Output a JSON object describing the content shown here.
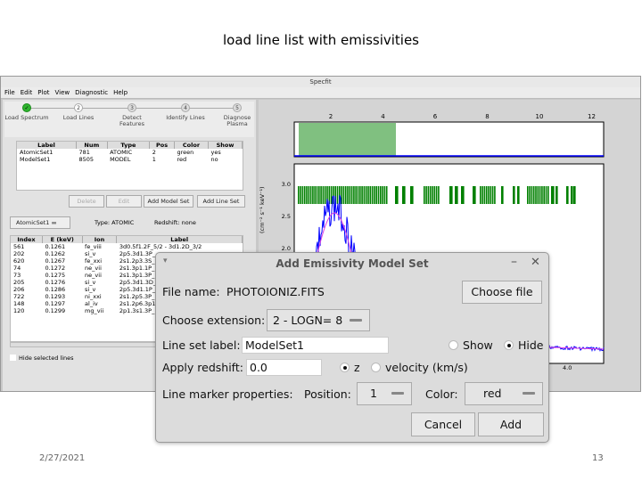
{
  "slide": {
    "title": "load line list with emissivities",
    "date": "2/27/2021",
    "page": "13"
  },
  "window": {
    "title": "Specfit"
  },
  "menu": [
    "File",
    "Edit",
    "Plot",
    "View",
    "Diagnostic",
    "Help"
  ],
  "wizard": [
    {
      "num": "✓",
      "label": "Load Spectrum",
      "done": true
    },
    {
      "num": "2",
      "label": "Load Lines"
    },
    {
      "num": "3",
      "label": "Detect Features"
    },
    {
      "num": "4",
      "label": "Identify Lines"
    },
    {
      "num": "5",
      "label": "Diagnose Plasma"
    }
  ],
  "linesets": {
    "headers": [
      "Label",
      "Num",
      "Type",
      "Pos",
      "Color",
      "Show"
    ],
    "rows": [
      [
        "AtomicSet1",
        "781",
        "ATOMIC",
        "2",
        "green",
        "yes"
      ],
      [
        "ModelSet1",
        "8505",
        "MODEL",
        "1",
        "red",
        "no"
      ]
    ]
  },
  "buttons": {
    "delete": "Delete",
    "edit": "Edit",
    "add_model": "Add Model Set",
    "add_line": "Add Line Set"
  },
  "lineview": {
    "selected": "AtomicSet1",
    "type": "Type: ATOMIC",
    "redshift": "Redshift: none",
    "headers": [
      "Index",
      "E (keV)",
      "Ion",
      "Label"
    ],
    "rows": [
      [
        "561",
        "0.1261",
        "fe_viii",
        "3d0.5f1.2F_5/2 - 3d1.2D_3/2"
      ],
      [
        "202",
        "0.1262",
        "si_v",
        "2p5.3d1.3P_"
      ],
      [
        "620",
        "0.1267",
        "fe_xxi",
        "2s1.2p3.3S_"
      ],
      [
        "74",
        "0.1272",
        "ne_vii",
        "2s1.3p1.1P_"
      ],
      [
        "73",
        "0.1275",
        "ne_vii",
        "2s1.3p1.3P_"
      ],
      [
        "205",
        "0.1276",
        "si_v",
        "2p5.3d1.3D_"
      ],
      [
        "206",
        "0.1286",
        "si_v",
        "2p5.3d1.1P_"
      ],
      [
        "722",
        "0.1293",
        "ni_xxi",
        "2s1.2p5.3P_"
      ],
      [
        "148",
        "0.1297",
        "al_iv",
        "2s1.2p6.3p1"
      ],
      [
        "120",
        "0.1299",
        "mg_vii",
        "2p1.3s1.3P_"
      ]
    ],
    "hide_selected": "Hide selected lines"
  },
  "plot": {
    "top_ticks": [
      "2",
      "4",
      "6",
      "8",
      "10",
      "12"
    ],
    "y_ticks": [
      "3.0",
      "2.5",
      "2.0"
    ],
    "ylabel": "(cm⁻² s⁻¹ keV⁻¹)",
    "bottom_tick": "4.0"
  },
  "dialog": {
    "title": "Add Emissivity Model Set",
    "file_label": "File name:",
    "file_value": "PHOTOIONIZ.FITS",
    "choose_file": "Choose file",
    "ext_label": "Choose extension:",
    "ext_value": "2 - LOGN= 8",
    "set_label": "Line set label:",
    "set_value": "ModelSet1",
    "show": "Show",
    "hide": "Hide",
    "redshift_label": "Apply redshift:",
    "redshift_value": "0.0",
    "z": "z",
    "velocity": "velocity (km/s)",
    "marker_label": "Line marker properties:",
    "position_label": "Position:",
    "position_value": "1",
    "color_label": "Color:",
    "color_value": "red",
    "cancel": "Cancel",
    "add": "Add"
  },
  "colors": {
    "marker": "#008000",
    "spectrum": "#0000ff",
    "model": "#e040e0",
    "overview_span": "#80c080"
  }
}
